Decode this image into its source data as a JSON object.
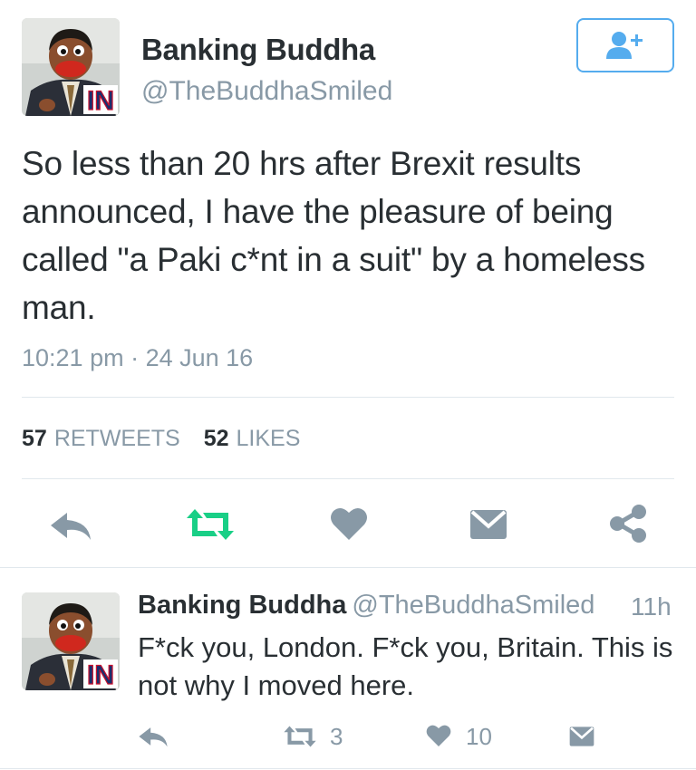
{
  "tweet": {
    "author_name": "Banking Buddha",
    "author_handle": "@TheBuddhaSmiled",
    "avatar_text": "IN",
    "text": "So less than 20 hrs after Brexit results announced, I have the pleasure of being called \"a Paki c*nt in a suit\" by a homeless man.",
    "timestamp": "10:21 pm · 24 Jun 16",
    "retweets_count": "57",
    "retweets_label": "RETWEETS",
    "likes_count": "52",
    "likes_label": "LIKES"
  },
  "actions": {
    "icons": [
      "reply-icon",
      "retweet-icon",
      "heart-icon",
      "message-icon",
      "share-icon"
    ]
  },
  "reply": {
    "author_name": "Banking Buddha",
    "author_handle": "@TheBuddhaSmiled",
    "time": "11h",
    "text": "F*ck you, London. F*ck you, Britain. This is not why I moved here.",
    "retweet_count": "3",
    "like_count": "10"
  },
  "colors": {
    "accent_blue": "#55acee",
    "retweet_green": "#19cf86",
    "icon_gray": "#8899a6",
    "text_dark": "#292f33",
    "divider": "#e1e8ed"
  }
}
